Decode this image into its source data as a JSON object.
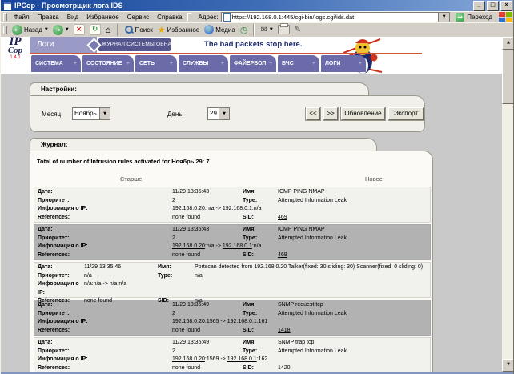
{
  "titlebar": {
    "title": "IPCop - Просмотрщик лога IDS"
  },
  "menubar": {
    "items": [
      "Файл",
      "Правка",
      "Вид",
      "Избранное",
      "Сервис",
      "Справка"
    ]
  },
  "addressbar": {
    "label": "Адрес:",
    "url": "https://192.168.0.1:445/cgi-bin/logs.cgi/ids.dat",
    "go": "Переход"
  },
  "toolbar": {
    "back": "Назад",
    "search": "Поиск",
    "favorites": "Избранное",
    "media": "Медиа"
  },
  "header": {
    "logo_ip": "IP",
    "logo_cop": "Cop",
    "version": "1.4.1",
    "section": "Логи",
    "banner": "Журнал Системы Обнаруж",
    "tagline": "The bad packets stop here.",
    "tabs": [
      "Система",
      "Состояние",
      "Сеть",
      "Службы",
      "Файервол",
      "ВЧС",
      "Логи"
    ]
  },
  "settings": {
    "title": "Настройки:",
    "month_label": "Месяц",
    "month": "Ноябрь",
    "day_label": "День:",
    "day": "29",
    "prev": "<<",
    "next": ">>",
    "refresh": "Обновление",
    "export": "Экспорт"
  },
  "journal": {
    "title": "Журнал:",
    "summary": "Total of number of Intrusion rules activated for Ноябрь 29: 7",
    "older": "Старше",
    "newer": "Новее",
    "labels": {
      "date": "Дата:",
      "name": "Имя:",
      "priority": "Приоритет:",
      "type": "Type:",
      "ip": "Информация о IP:",
      "refs": "References:",
      "sid": "SID:"
    },
    "entries": [
      {
        "shade": "light",
        "layout": "wide",
        "date": "11/29 13:35:43",
        "name": "ICMP PING NMAP",
        "priority": "2",
        "type": "Attempted Information Leak",
        "ip": {
          "linked": true,
          "src": "192.168.0.20",
          "sport": "n/a",
          "dst": "192.168.0.1",
          "dport": "n/a"
        },
        "refs": "none found",
        "sid": "469",
        "sid_linked": true
      },
      {
        "shade": "dark",
        "layout": "wide",
        "date": "11/29 13:35:43",
        "name": "ICMP PING NMAP",
        "priority": "2",
        "type": "Attempted Information Leak",
        "ip": {
          "linked": true,
          "src": "192.168.0.20",
          "sport": "n/a",
          "dst": "192.168.0.1",
          "dport": "n/a"
        },
        "refs": "none found",
        "sid": "469",
        "sid_linked": true
      },
      {
        "shade": "light",
        "layout": "narrow",
        "date": "11/29 13:35:46",
        "name": "Portscan detected from 192.168.0.20 Talker(fixed: 30 sliding: 30) Scanner(fixed: 0 sliding: 0)",
        "priority": "n/a",
        "type": "n/a",
        "ip": {
          "linked": false,
          "src": "n/a",
          "sport": "n/a",
          "dst": "n/a",
          "dport": "n/a"
        },
        "refs": "none found",
        "sid": "n/a",
        "sid_linked": false
      },
      {
        "shade": "dark",
        "layout": "wide",
        "date": "11/29 13:35:49",
        "name": "SNMP request tcp",
        "priority": "2",
        "type": "Attempted Information Leak",
        "ip": {
          "linked": true,
          "src": "192.168.0.20",
          "sport": "1565",
          "dst": "192.168.0.1",
          "dport": "161"
        },
        "refs": "none found",
        "sid": "1418",
        "sid_linked": true
      },
      {
        "shade": "light",
        "layout": "wide",
        "date": "11/29 13:35:49",
        "name": "SNMP trap tcp",
        "priority": "2",
        "type": "Attempted Information Leak",
        "ip": {
          "linked": true,
          "src": "192.168.0.20",
          "sport": "1569",
          "dst": "192.168.0.1",
          "dport": "162"
        },
        "refs": "none found",
        "sid": "1420",
        "sid_linked": false
      }
    ]
  },
  "icons": {
    "minimize": "_",
    "restore": "□",
    "close": "×",
    "back": "←",
    "forward": "→",
    "stop": "×",
    "refresh": "↻",
    "home": "⌂",
    "star": "★",
    "note": "♪",
    "clock": "◷",
    "mail": "✉",
    "edit": "✎",
    "chevron_down": "▼",
    "tri_up": "▲",
    "tri_down": "▼",
    "go_arrow": "→",
    "tab_plus": "+"
  },
  "colors": {
    "accent_purple": "#6b6baa",
    "banner_purple": "#56568e",
    "light_purple": "#9a9ac6",
    "red_line": "#cc5533",
    "entry_dark": "#b2b2b2",
    "titlebar_blue": "#16459c"
  }
}
